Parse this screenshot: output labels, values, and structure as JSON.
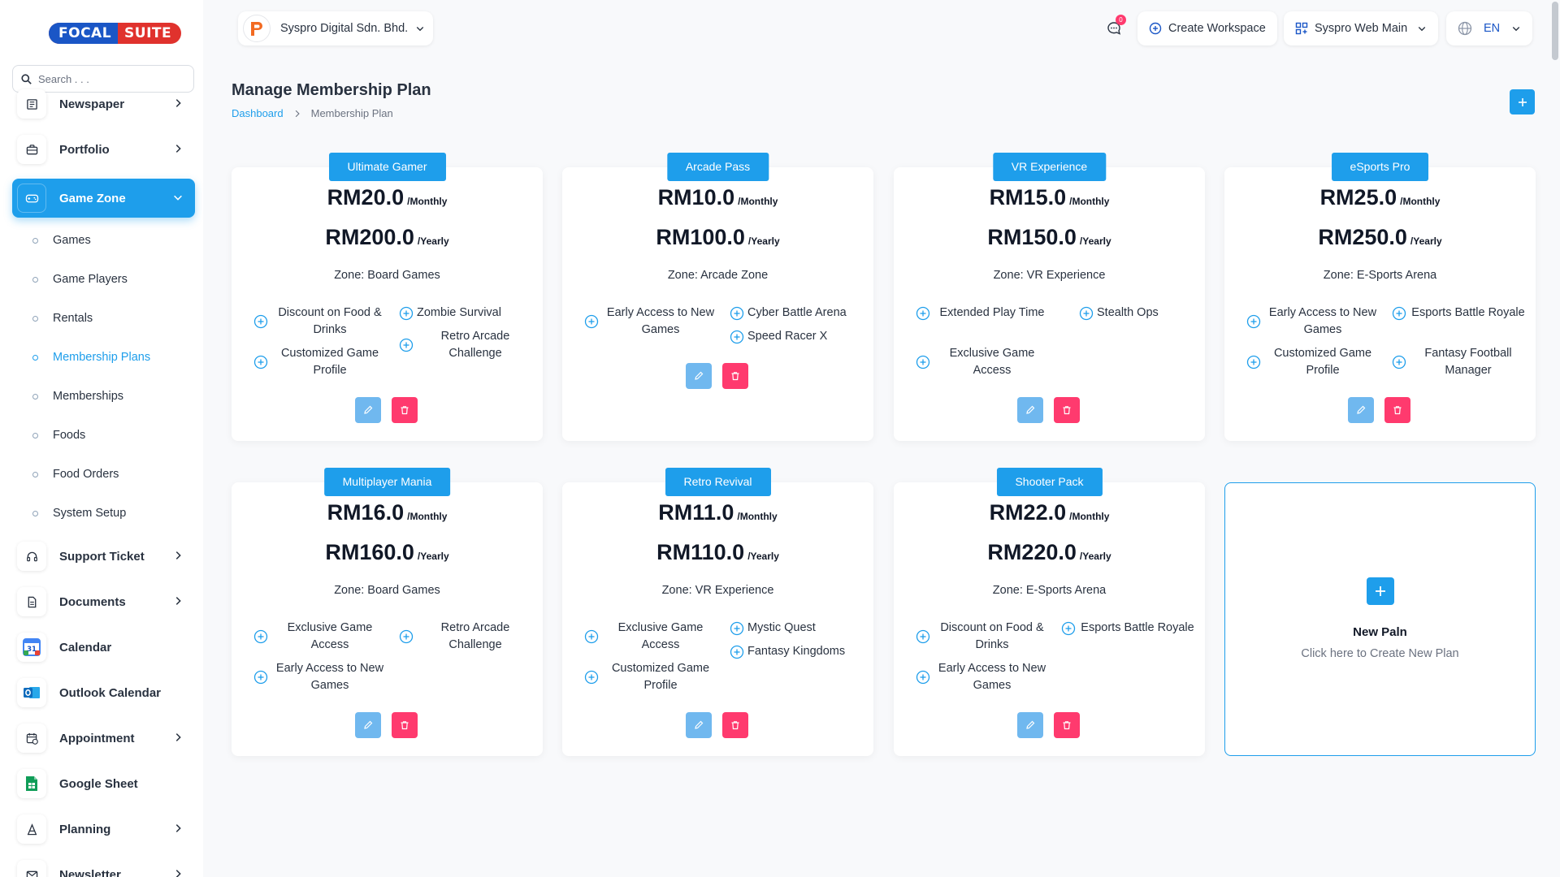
{
  "brand": {
    "focal": "FOCAL",
    "suite": "SUITE"
  },
  "search": {
    "placeholder": "Search . . ."
  },
  "sidebar": {
    "items": [
      {
        "label": "Newspaper"
      },
      {
        "label": "Portfolio"
      },
      {
        "label": "Game Zone"
      },
      {
        "label": "Support Ticket"
      },
      {
        "label": "Documents"
      },
      {
        "label": "Calendar"
      },
      {
        "label": "Outlook Calendar"
      },
      {
        "label": "Appointment"
      },
      {
        "label": "Google Sheet"
      },
      {
        "label": "Planning"
      },
      {
        "label": "Newsletter"
      }
    ],
    "sub_items": [
      {
        "label": "Games"
      },
      {
        "label": "Game Players"
      },
      {
        "label": "Rentals"
      },
      {
        "label": "Membership Plans"
      },
      {
        "label": "Memberships"
      },
      {
        "label": "Foods"
      },
      {
        "label": "Food Orders"
      },
      {
        "label": "System Setup"
      }
    ],
    "calendar_day": "31"
  },
  "header": {
    "company": "Syspro Digital Sdn. Bhd.",
    "notification_count": "0",
    "create_workspace": "Create Workspace",
    "workspace": "Syspro Web Main",
    "language": "EN"
  },
  "page": {
    "title": "Manage Membership Plan",
    "breadcrumb": {
      "home": "Dashboard",
      "current": "Membership Plan"
    }
  },
  "plans": [
    {
      "name": "Ultimate Gamer",
      "monthly": "RM20.0",
      "yearly": "RM200.0",
      "monthly_unit": "/Monthly",
      "yearly_unit": "/Yearly",
      "zone": "Zone: Board Games",
      "features": [
        "Discount on Food & Drinks",
        "Zombie Survival",
        "Retro Arcade Challenge",
        "Customized Game Profile"
      ]
    },
    {
      "name": "Arcade Pass",
      "monthly": "RM10.0",
      "yearly": "RM100.0",
      "monthly_unit": "/Monthly",
      "yearly_unit": "/Yearly",
      "zone": "Zone: Arcade Zone",
      "features": [
        "Early Access to New Games",
        "Cyber Battle Arena",
        "Speed Racer X"
      ]
    },
    {
      "name": "VR Experience",
      "monthly": "RM15.0",
      "yearly": "RM150.0",
      "monthly_unit": "/Monthly",
      "yearly_unit": "/Yearly",
      "zone": "Zone: VR Experience",
      "features": [
        "Extended Play Time",
        "Stealth Ops",
        "Exclusive Game Access"
      ]
    },
    {
      "name": "eSports Pro",
      "monthly": "RM25.0",
      "yearly": "RM250.0",
      "monthly_unit": "/Monthly",
      "yearly_unit": "/Yearly",
      "zone": "Zone: E-Sports Arena",
      "features": [
        "Early Access to New Games",
        "Esports Battle Royale",
        "Customized Game Profile",
        "Fantasy Football Manager"
      ]
    },
    {
      "name": "Multiplayer Mania",
      "monthly": "RM16.0",
      "yearly": "RM160.0",
      "monthly_unit": "/Monthly",
      "yearly_unit": "/Yearly",
      "zone": "Zone: Board Games",
      "features": [
        "Exclusive Game Access",
        "Retro Arcade Challenge",
        "Early Access to New Games"
      ]
    },
    {
      "name": "Retro Revival",
      "monthly": "RM11.0",
      "yearly": "RM110.0",
      "monthly_unit": "/Monthly",
      "yearly_unit": "/Yearly",
      "zone": "Zone: VR Experience",
      "features": [
        "Exclusive Game Access",
        "Mystic Quest",
        "Fantasy Kingdoms",
        "Customized Game Profile"
      ]
    },
    {
      "name": "Shooter Pack",
      "monthly": "RM22.0",
      "yearly": "RM220.0",
      "monthly_unit": "/Monthly",
      "yearly_unit": "/Yearly",
      "zone": "Zone: E-Sports Arena",
      "features": [
        "Discount on Food & Drinks",
        "Esports Battle Royale",
        "Early Access to New Games"
      ]
    }
  ],
  "new_plan": {
    "title": "New Paln",
    "subtitle": "Click here to Create New Plan"
  },
  "colors": {
    "accent": "#1e9eeb",
    "danger": "#ff3a6e",
    "edit": "#70b8ef",
    "brand_red": "#e0322d",
    "brand_blue": "#1a56c6"
  }
}
